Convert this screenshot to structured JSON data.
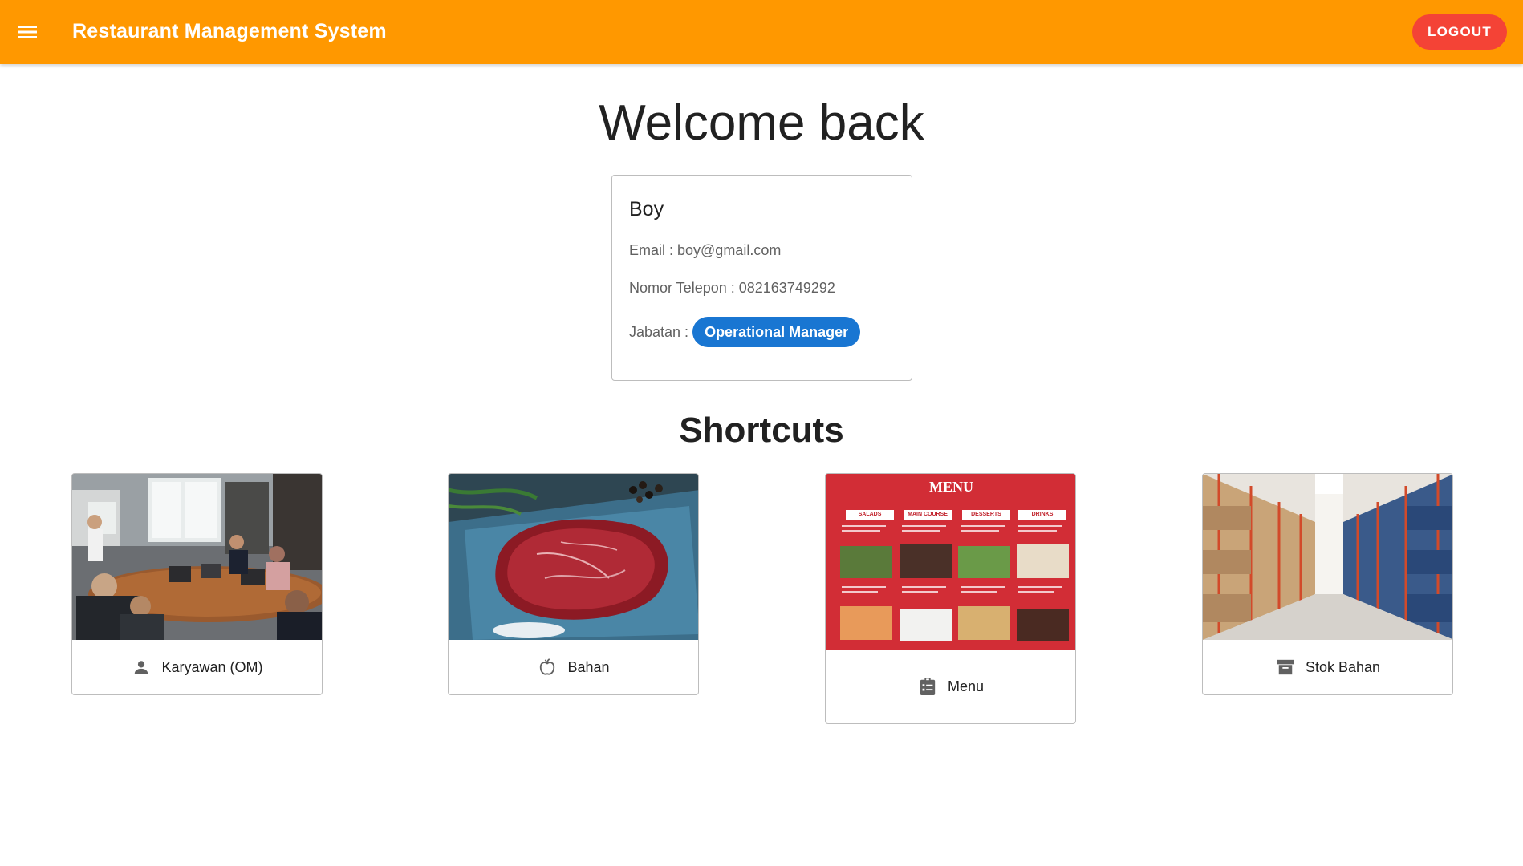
{
  "appbar": {
    "title": "Restaurant Management System",
    "logout_label": "LOGOUT",
    "color": "#ff9800"
  },
  "welcome": {
    "heading": "Welcome back"
  },
  "profile": {
    "name": "Boy",
    "email_line": "Email : boy@gmail.com",
    "phone_line": "Nomor Telepon : 082163749292",
    "role_label": "Jabatan :",
    "role_value": "Operational Manager",
    "role_color": "#1976d2"
  },
  "shortcuts": {
    "heading": "Shortcuts",
    "items": [
      {
        "label": "Karyawan (OM)",
        "icon": "person-icon",
        "image": "office-meeting-photo"
      },
      {
        "label": "Bahan",
        "icon": "apple-icon",
        "image": "raw-steak-photo"
      },
      {
        "label": "Menu",
        "icon": "clipboard-list-icon",
        "image": "restaurant-menu-board",
        "menu_board": {
          "title": "MENU",
          "columns": [
            "SALADS",
            "MAIN COURSE",
            "DESSERTS",
            "DRINKS"
          ]
        }
      },
      {
        "label": "Stok Bahan",
        "icon": "archive-box-icon",
        "image": "warehouse-shelves-photo"
      }
    ]
  }
}
